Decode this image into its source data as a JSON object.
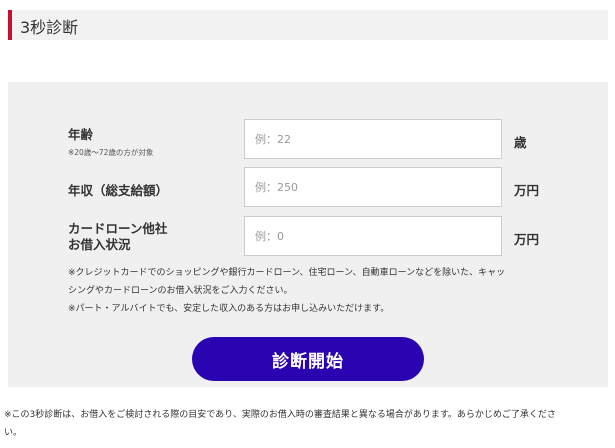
{
  "header": {
    "title": "3秒診断"
  },
  "form": {
    "age": {
      "label": "年齢",
      "note": "※20歳〜72歳の方が対象",
      "placeholder": "例：22",
      "unit": "歳"
    },
    "income": {
      "label": "年収（総支給額）",
      "placeholder": "例：250",
      "unit": "万円"
    },
    "loans": {
      "label_line1": "カードローン他社",
      "label_line2": "お借入状況",
      "placeholder": "例：0",
      "unit": "万円"
    },
    "notes": [
      "※クレジットカードでのショッピングや銀行カードローン、住宅ローン、自動車ローンなどを除いた、キャッ",
      "シングやカードローンのお借入状況をご入力ください。",
      "※パート・アルバイトでも、安定した収入のある方はお申し込みいただけます。"
    ],
    "submit_label": "診断開始"
  },
  "footnote": {
    "line1": "※この3秒診断は、お借入をご検討される際の目安であり、実際のお借入時の審査結果と異なる場合があります。あらかじめご了承くださ",
    "line2": "い。"
  },
  "colors": {
    "accent": "#c8102e",
    "button": "#2a04b0",
    "panel": "#f0f0f0"
  }
}
